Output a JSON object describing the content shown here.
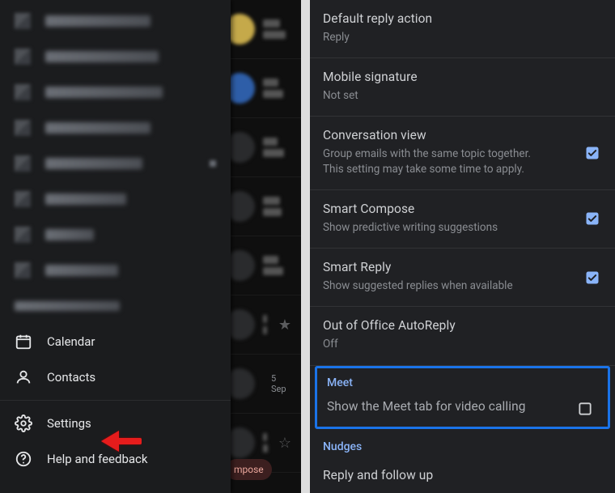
{
  "drawer": {
    "items": [
      {
        "label": "Calendar"
      },
      {
        "label": "Contacts"
      },
      {
        "label": "Settings"
      },
      {
        "label": "Help and feedback"
      }
    ]
  },
  "settings": {
    "default_reply": {
      "title": "Default reply action",
      "value": "Reply"
    },
    "signature": {
      "title": "Mobile signature",
      "value": "Not set"
    },
    "conversation": {
      "title": "Conversation view",
      "desc": "Group emails with the same topic together. This setting may take some time to apply."
    },
    "smart_compose": {
      "title": "Smart Compose",
      "desc": "Show predictive writing suggestions"
    },
    "smart_reply": {
      "title": "Smart Reply",
      "desc": "Show suggested replies when available"
    },
    "ooo": {
      "title": "Out of Office AutoReply",
      "value": "Off"
    },
    "meet_section": "Meet",
    "meet_toggle": {
      "desc": "Show the Meet tab for video calling"
    },
    "nudges_section": "Nudges",
    "nudges_item": {
      "title": "Reply and follow up"
    }
  },
  "inbox_hint": {
    "date": "5 Sep",
    "compose": "mpose"
  }
}
